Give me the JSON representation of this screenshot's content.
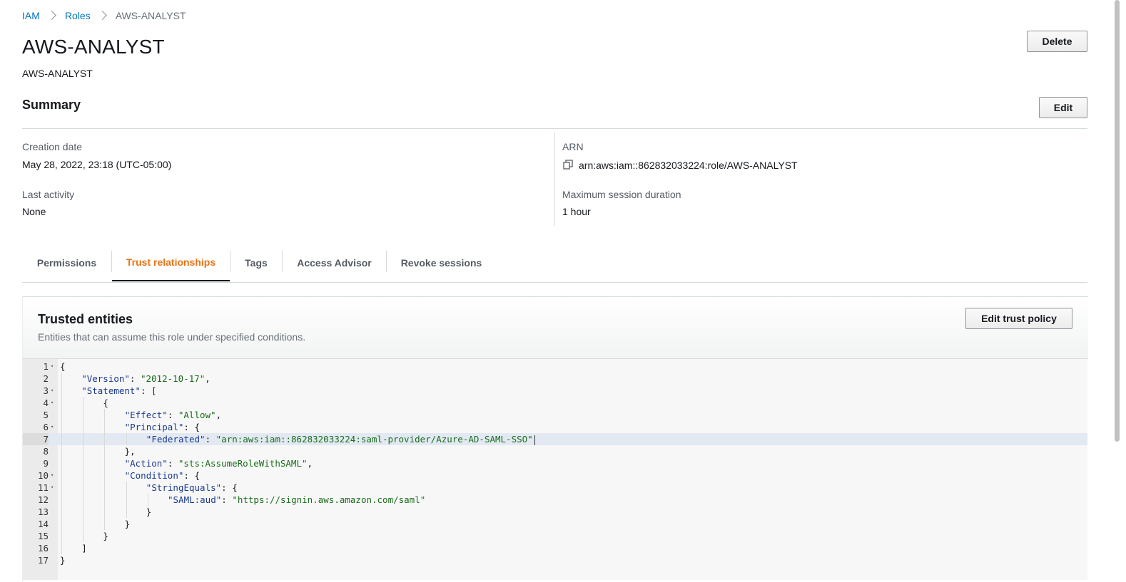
{
  "breadcrumb": {
    "items": [
      "IAM",
      "Roles",
      "AWS-ANALYST"
    ]
  },
  "header": {
    "title": "AWS-ANALYST",
    "subtitle": "AWS-ANALYST",
    "delete_label": "Delete"
  },
  "summary": {
    "title": "Summary",
    "edit_label": "Edit",
    "creation_date_label": "Creation date",
    "creation_date": "May 28, 2022, 23:18 (UTC-05:00)",
    "last_activity_label": "Last activity",
    "last_activity": "None",
    "arn_label": "ARN",
    "arn": "arn:aws:iam::862832033224:role/AWS-ANALYST",
    "max_session_label": "Maximum session duration",
    "max_session": "1 hour"
  },
  "tabs": [
    {
      "label": "Permissions",
      "active": false
    },
    {
      "label": "Trust relationships",
      "active": true
    },
    {
      "label": "Tags",
      "active": false
    },
    {
      "label": "Access Advisor",
      "active": false
    },
    {
      "label": "Revoke sessions",
      "active": false
    }
  ],
  "trusted_entities": {
    "title": "Trusted entities",
    "description": "Entities that can assume this role under specified conditions.",
    "edit_label": "Edit trust policy"
  },
  "policy_lines": [
    {
      "num": "1",
      "fold": true,
      "text": "{"
    },
    {
      "num": "2",
      "fold": false,
      "text": "    \"Version\": \"2012-10-17\","
    },
    {
      "num": "3",
      "fold": true,
      "text": "    \"Statement\": ["
    },
    {
      "num": "4",
      "fold": true,
      "text": "        {"
    },
    {
      "num": "5",
      "fold": false,
      "text": "            \"Effect\": \"Allow\","
    },
    {
      "num": "6",
      "fold": true,
      "text": "            \"Principal\": {"
    },
    {
      "num": "7",
      "fold": false,
      "text": "                \"Federated\": \"arn:aws:iam::862832033224:saml-provider/Azure-AD-SAML-SSO\"",
      "highlight": true
    },
    {
      "num": "8",
      "fold": false,
      "text": "            },"
    },
    {
      "num": "9",
      "fold": false,
      "text": "            \"Action\": \"sts:AssumeRoleWithSAML\","
    },
    {
      "num": "10",
      "fold": true,
      "text": "            \"Condition\": {"
    },
    {
      "num": "11",
      "fold": true,
      "text": "                \"StringEquals\": {"
    },
    {
      "num": "12",
      "fold": false,
      "text": "                    \"SAML:aud\": \"https://signin.aws.amazon.com/saml\""
    },
    {
      "num": "13",
      "fold": false,
      "text": "                }"
    },
    {
      "num": "14",
      "fold": false,
      "text": "            }"
    },
    {
      "num": "15",
      "fold": false,
      "text": "        }"
    },
    {
      "num": "16",
      "fold": false,
      "text": "    ]"
    },
    {
      "num": "17",
      "fold": false,
      "text": "}"
    }
  ],
  "colors": {
    "link": "#0073bb",
    "active_tab": "#ec7211",
    "json_key": "#1a3a8f",
    "json_string": "#1a6b1a"
  }
}
